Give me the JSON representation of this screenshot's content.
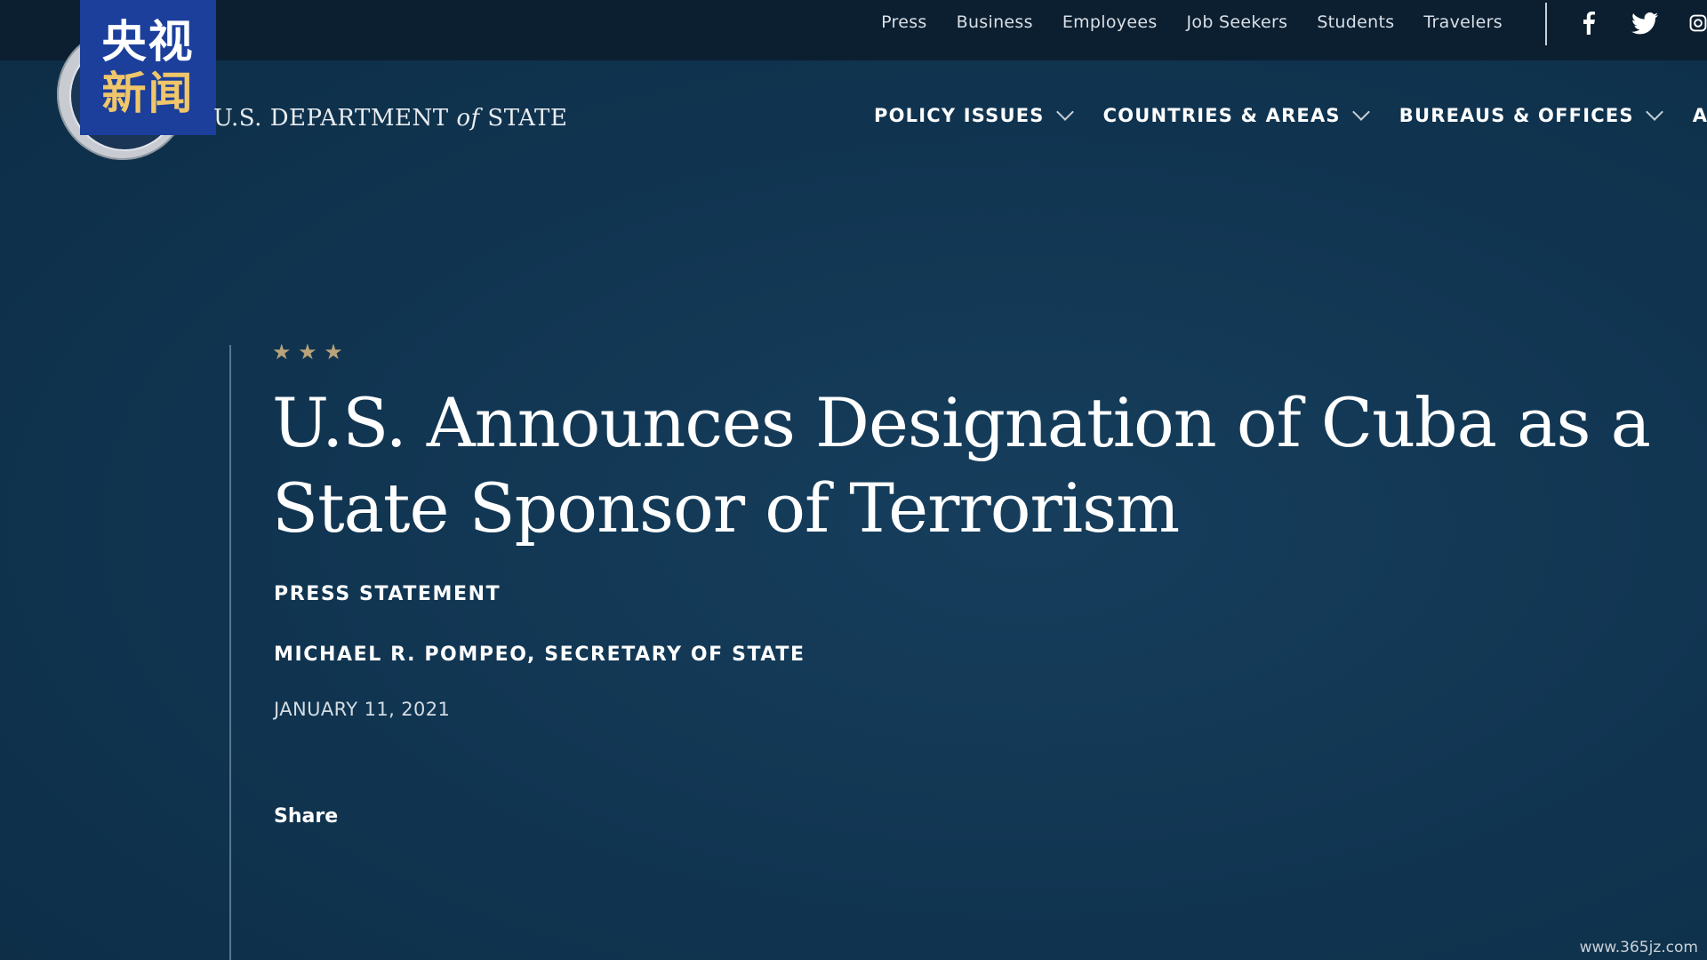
{
  "utility_nav": {
    "links": [
      "Press",
      "Business",
      "Employees",
      "Job Seekers",
      "Students",
      "Travelers"
    ],
    "social": [
      "facebook-icon",
      "twitter-icon",
      "instagram-icon"
    ]
  },
  "overlay_logo": {
    "line1": "央视",
    "line2": "新闻"
  },
  "header": {
    "brand_prefix": "U.S. DEPARTMENT ",
    "brand_of": "of",
    "brand_suffix": " STATE"
  },
  "main_nav": {
    "items": [
      "POLICY ISSUES",
      "COUNTRIES & AREAS",
      "BUREAUS & OFFICES",
      "ABOUT"
    ]
  },
  "article": {
    "stars": "★ ★ ★",
    "title": "U.S. Announces Designation of Cuba as a State Sponsor of Terrorism",
    "type": "PRESS STATEMENT",
    "author": "MICHAEL R. POMPEO, SECRETARY OF STATE",
    "date": "JANUARY 11, 2021",
    "share_label": "Share"
  },
  "watermark": "www.365jz.com",
  "colors": {
    "background": "#103450",
    "utility_bar": "#0c1f31",
    "star_gold": "#b9a37a",
    "cctv_blue": "#1c3f9b"
  }
}
